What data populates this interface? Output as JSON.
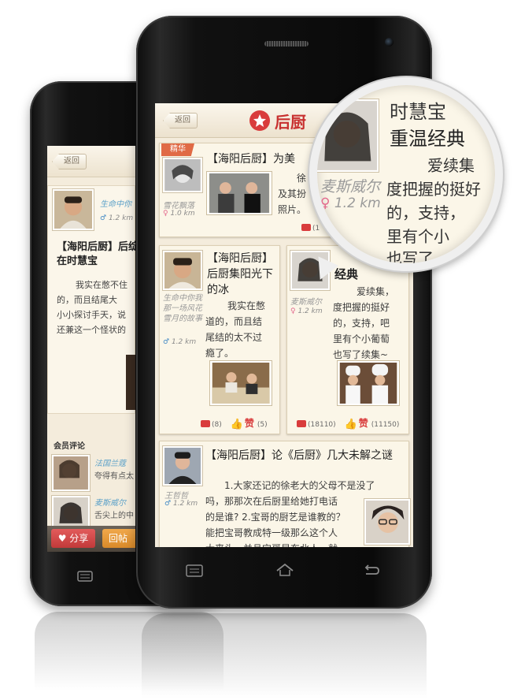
{
  "back_screen": {
    "back_button": "返回",
    "post_author": {
      "name": "生命中你",
      "distance": "1.2 km",
      "gender": "♂"
    },
    "post_title": "【海阳后厨】后绽放在时慧宝",
    "post_body": [
      "我实在憋不住",
      "的，而且结尾大",
      "小小探讨手天，说",
      "还兼这一个怪状的"
    ],
    "comments_heading": "会员评论",
    "comments": [
      {
        "name": "法国兰蔻",
        "text": "夸得有点太"
      },
      {
        "name": "麦斯威尔",
        "text": "舌尖上的中"
      }
    ],
    "share_label": "分享",
    "reply_label": "回帖"
  },
  "front_screen": {
    "back_button": "返回",
    "app_title": "后厨",
    "cards": [
      {
        "badge": "精华",
        "title": "【海阳后厨】为美",
        "author": "雪花飘落",
        "gender": "♀",
        "distance": "1.0 km",
        "body": [
          "徐",
          "及其扮",
          "照片。"
        ],
        "comment_count": "(1"
      },
      {
        "title": "【海阳后厨】后厨集阳光下的冰",
        "author": "生命中你我那一场风花雪月的故事",
        "gender": "♂",
        "distance": "1.2 km",
        "body": [
          "我实在憋",
          "道的，而且结",
          "尾结的太不过",
          "瘾了。"
        ],
        "comment_count": "(8)",
        "like_label": "赞",
        "like_count": "(5)"
      },
      {
        "title": "经典",
        "author": "麦斯威尔",
        "gender": "♀",
        "distance": "1.2 km",
        "body": [
          "爱续集，",
          "度把握的挺好",
          "的，支持，吧",
          "里有个小葡萄",
          "也写了续集~"
        ],
        "comment_count": "(18110)",
        "like_label": "赞",
        "like_count": "(11150)"
      },
      {
        "title": "【海阳后厨】论《后厨》几大未解之谜",
        "author": "王哲哲",
        "gender": "♂",
        "distance": "1.2 km",
        "body": [
          "1.大家还记的徐老大的父母不是没了",
          "吗，那那次在后厨里给她打电话",
          "的是谁? 2.宝哥的厨艺是谁教的？",
          "能把宝哥教成特一级那么这个人",
          "大来头，并且宝哥是东北人，就"
        ]
      }
    ]
  },
  "magnifier": {
    "line1": "时慧宝",
    "line2": "重温经典",
    "line3": "爱续集",
    "author": "麦斯威尔",
    "distance": "1.2 km",
    "body": [
      "度把握的挺好",
      "的，支持，",
      "里有个小",
      "也写了"
    ]
  }
}
